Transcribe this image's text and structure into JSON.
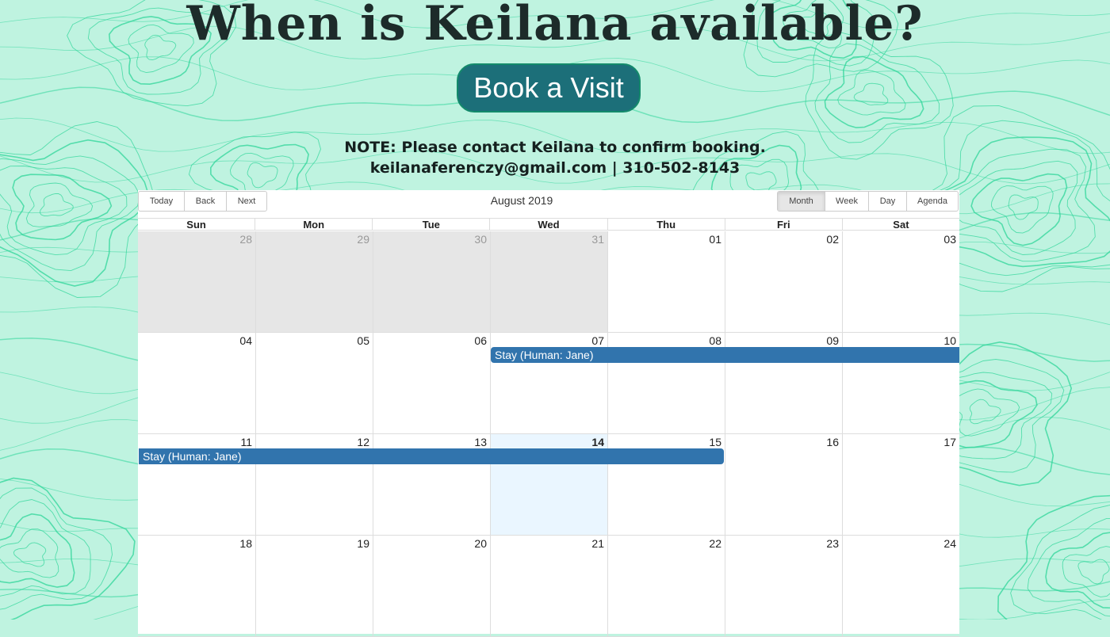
{
  "header": {
    "title": "When is Keilana available?",
    "book_button": "Book a Visit",
    "note_line1": "NOTE: Please contact Keilana to confirm booking.",
    "note_line2": "keilanaferenczy@gmail.com | 310-502-8143"
  },
  "toolbar": {
    "nav": [
      "Today",
      "Back",
      "Next"
    ],
    "label": "August 2019",
    "views": [
      "Month",
      "Week",
      "Day",
      "Agenda"
    ],
    "active_view": "Month"
  },
  "calendar": {
    "weekdays": [
      "Sun",
      "Mon",
      "Tue",
      "Wed",
      "Thu",
      "Fri",
      "Sat"
    ],
    "weeks": [
      [
        "28",
        "29",
        "30",
        "31",
        "01",
        "02",
        "03"
      ],
      [
        "04",
        "05",
        "06",
        "07",
        "08",
        "09",
        "10"
      ],
      [
        "11",
        "12",
        "13",
        "14",
        "15",
        "16",
        "17"
      ],
      [
        "18",
        "19",
        "20",
        "21",
        "22",
        "23",
        "24"
      ]
    ],
    "off_range": [
      "28",
      "29",
      "30",
      "31"
    ],
    "today": "14",
    "events": [
      {
        "title": "Stay (Human: Jane)",
        "start": "2019-08-07",
        "end": "2019-08-15",
        "continues_after": true
      },
      {
        "title": "Stay (Human: Jane)",
        "start": "2019-08-07",
        "end": "2019-08-15",
        "continues_before": true
      }
    ]
  },
  "colors": {
    "background": "#bff3e0",
    "topo_lines": "#2fd69a",
    "button_bg": "#1c6f79",
    "event_bg": "#3174ad",
    "today_bg": "#eaf6ff",
    "off_range_bg": "#e6e6e6"
  }
}
